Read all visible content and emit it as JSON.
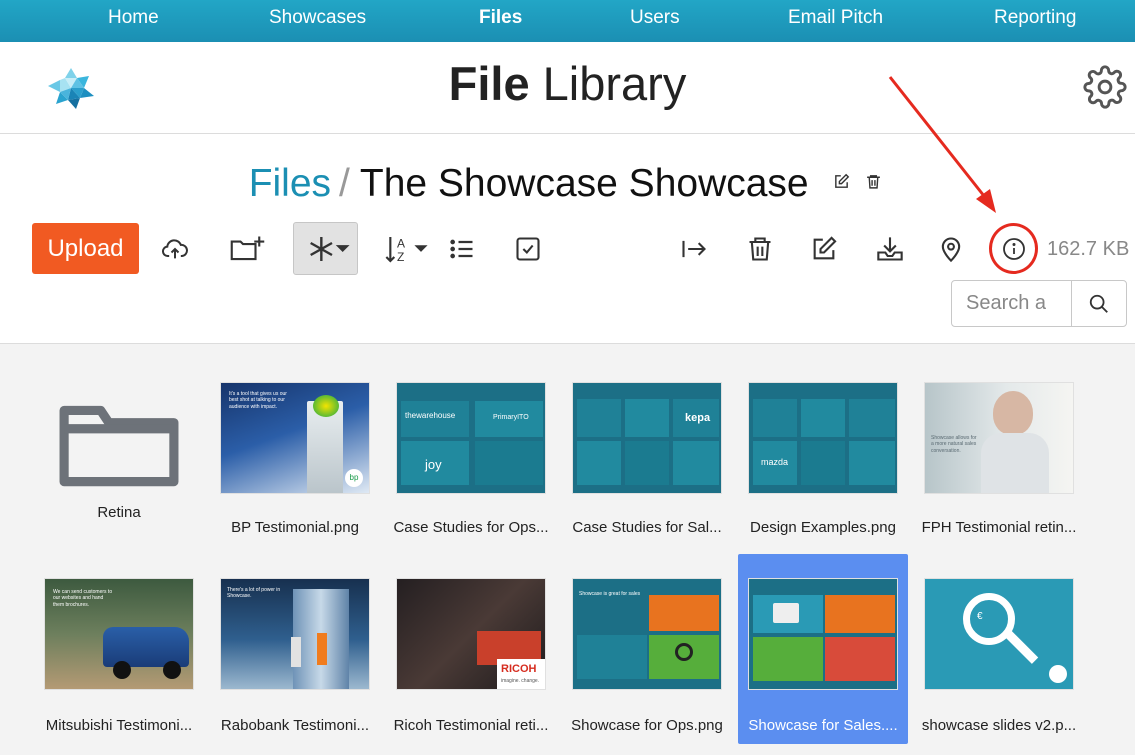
{
  "nav": {
    "items": [
      "Home",
      "Showcases",
      "Files",
      "Users",
      "Email Pitch",
      "Reporting"
    ],
    "active": "Files"
  },
  "header": {
    "title_bold": "File",
    "title_rest": " Library"
  },
  "breadcrumb": {
    "root": "Files",
    "separator": "/",
    "current": "The Showcase Showcase"
  },
  "toolbar": {
    "upload_label": "Upload",
    "total_size": "162.7 KB"
  },
  "search": {
    "placeholder": "Search a"
  },
  "colors": {
    "nav_bg": "#1b8fb3",
    "accent": "#1b8fb3",
    "upload": "#f15a22",
    "selected": "#5b8ef0",
    "highlight": "#e52a1f"
  },
  "files": [
    {
      "name": "Retina",
      "type": "folder"
    },
    {
      "name": "BP Testimonial.png",
      "type": "image"
    },
    {
      "name": "Case Studies for Ops...",
      "type": "image"
    },
    {
      "name": "Case Studies for Sal...",
      "type": "image"
    },
    {
      "name": "Design Examples.png",
      "type": "image"
    },
    {
      "name": "FPH Testimonial retin...",
      "type": "image"
    },
    {
      "name": "Mitsubishi Testimoni...",
      "type": "image"
    },
    {
      "name": "Rabobank Testimoni...",
      "type": "image"
    },
    {
      "name": "Ricoh Testimonial reti...",
      "type": "image"
    },
    {
      "name": "Showcase for Ops.png",
      "type": "image"
    },
    {
      "name": "Showcase for Sales....",
      "type": "image",
      "selected": true
    },
    {
      "name": "showcase slides v2.p...",
      "type": "image"
    }
  ],
  "thumb_text": {
    "bp_quote": "It's a tool that gives us our best shot at talking to our audience with impact.",
    "bp_logo": "bp",
    "warehouse": "thewarehouse",
    "primary_ito": "PrimaryITO",
    "joy": "joy",
    "kepa": "kepa",
    "mazda": "mazda",
    "fph_caption": "Showcase allows for a more natural sales conversation.",
    "mitsu_quote": "We can send customers to our websites and hand them brochures.",
    "rabo_quote": "There's a lot of power in Showcase.",
    "ricoh_logo": "RICOH",
    "ricoh_tag": "imagine. change.",
    "ops_heading": "Showcase is great for sales",
    "euro": "€"
  }
}
